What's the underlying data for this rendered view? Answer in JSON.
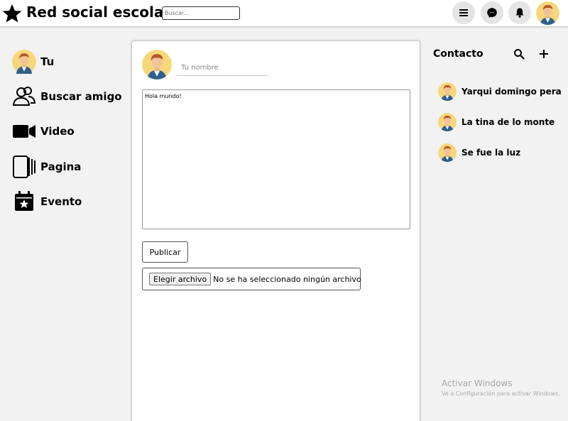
{
  "header": {
    "title": "Red social escolar",
    "search_placeholder": "Buscar...",
    "icons": [
      "star-icon",
      "menu-icon",
      "messenger-icon",
      "bell-icon"
    ]
  },
  "sidebar": {
    "items": [
      {
        "label": "Tu",
        "icon": "user-avatar"
      },
      {
        "label": "Buscar amigo",
        "icon": "users-icon"
      },
      {
        "label": "Video",
        "icon": "video-icon"
      },
      {
        "label": "Pagina",
        "icon": "pages-icon"
      },
      {
        "label": "Evento",
        "icon": "calendar-icon"
      }
    ]
  },
  "composer": {
    "name_placeholder": "Tu nombre",
    "post_text": "Hola mundo!",
    "publish_label": "Publicar",
    "file_button": "Elegir archivo",
    "file_status": "No se ha seleccionado ningún archivo"
  },
  "contacts": {
    "title": "Contacto",
    "list": [
      {
        "name": "Yarqui domingo pera"
      },
      {
        "name": "La tina de lo monte"
      },
      {
        "name": "Se fue la luz"
      }
    ]
  },
  "watermark": {
    "line1": "Activar Windows",
    "line2": "Ve a Configuración para activar Windows."
  }
}
